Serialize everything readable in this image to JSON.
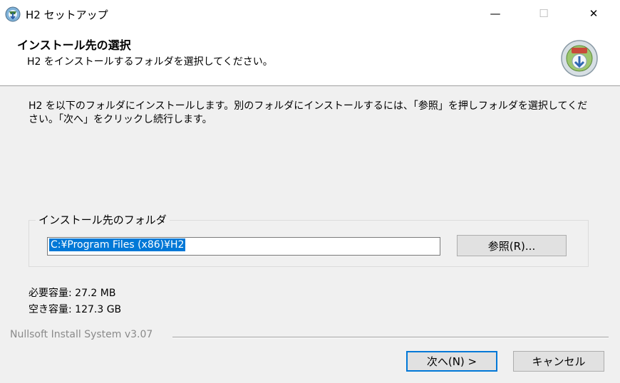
{
  "window": {
    "title": "H2 セットアップ",
    "minimize_symbol": "—",
    "maximize_symbol": "☐",
    "close_symbol": "✕"
  },
  "header": {
    "title": "インストール先の選択",
    "subtitle": "H2 をインストールするフォルダを選択してください。",
    "logo_icon": "installer-disk-icon"
  },
  "body": {
    "instructions": "H2 を以下のフォルダにインストールします。別のフォルダにインストールするには、「参照」を押しフォルダを選択してください。「次へ」をクリックし続行します。"
  },
  "destination": {
    "group_label": "インストール先のフォルダ",
    "path_value": "C:¥Program Files (x86)¥H2",
    "browse_label": "参照(R)..."
  },
  "space": {
    "required": "必要容量: 27.2 MB",
    "available": "空き容量: 127.3 GB"
  },
  "footer": {
    "branding": "Nullsoft Install System v3.07",
    "next_label": "次へ(N) >",
    "cancel_label": "キャンセル"
  },
  "colors": {
    "selection": "#0078d7",
    "dialog_bg": "#f0f0f0",
    "button_bg": "#e1e1e1"
  }
}
